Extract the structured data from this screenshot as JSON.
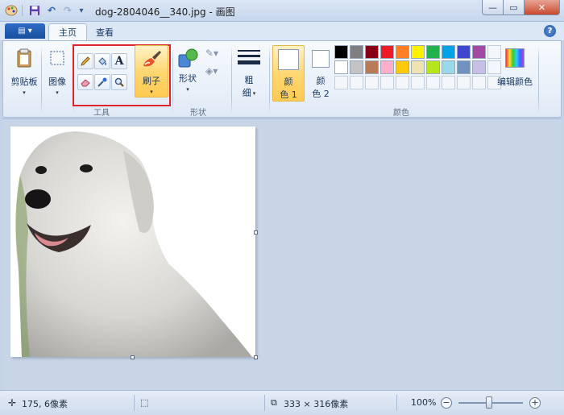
{
  "window": {
    "title": "dog-2804046__340.jpg - 画图",
    "minimize": "—",
    "maximize": "▭",
    "close": "✕"
  },
  "quick_access": {
    "save_icon": "💾",
    "undo_icon": "↶",
    "redo_icon": "↷",
    "customize_icon": "▾"
  },
  "tabs": {
    "app_menu": "▤ ▾",
    "home": "主页",
    "view": "查看",
    "help": "?"
  },
  "ribbon": {
    "clipboard": {
      "label": "剪贴板",
      "drop": "▾"
    },
    "image": {
      "label": "图像",
      "drop": "▾"
    },
    "tools": {
      "group_label": "工具"
    },
    "brushes": {
      "label": "刷子",
      "drop": "▾"
    },
    "shapes": {
      "label": "形状",
      "drop": "▾",
      "group_label": "形状"
    },
    "size": {
      "label_line1": "粗",
      "label_line2": "细",
      "drop": "▾"
    },
    "color1": {
      "label_line1": "颜",
      "label_line2": "色 1"
    },
    "color2": {
      "label_line1": "颜",
      "label_line2": "色 2"
    },
    "colors_group_label": "颜色",
    "edit_colors": "编辑颜色",
    "palette": [
      "#000000",
      "#7f7f7f",
      "#880015",
      "#ed1c24",
      "#ff7f27",
      "#fff200",
      "#22b14c",
      "#00a2e8",
      "#3f48cc",
      "#a349a4",
      "#ffffff",
      "#c3c3c3",
      "#b97a57",
      "#ffaec9",
      "#ffc90e",
      "#efe4b0",
      "#b5e61d",
      "#99d9ea",
      "#7092be",
      "#c8bfe7"
    ]
  },
  "status": {
    "cursor_pos": "175, 6像素",
    "canvas_size": "333 × 316像素",
    "zoom": "100%",
    "zoom_out": "−",
    "zoom_in": "+"
  }
}
